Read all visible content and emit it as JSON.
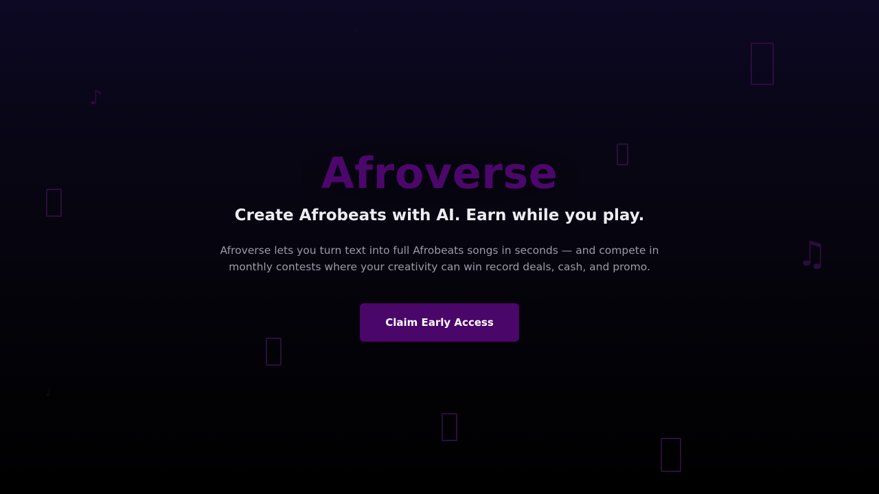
{
  "brand": {
    "name": "Afroverse",
    "color": "#4c076b"
  },
  "hero": {
    "tagline": "Create Afrobeats with AI. Earn while you play.",
    "description": "Afroverse lets you turn text into full Afrobeats songs in seconds — and compete in monthly contests where your creativity can win record deals, cash, and promo."
  },
  "cta": {
    "label": "Claim Early Access",
    "background": "#4a0669"
  },
  "background": {
    "gradient_top": "#0d0824",
    "gradient_bottom": "#000000",
    "decorations": {
      "note_single": "♪",
      "note_double": "♫",
      "note_small": "♩"
    }
  }
}
